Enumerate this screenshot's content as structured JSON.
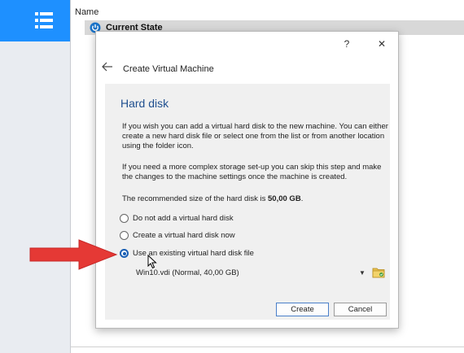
{
  "list": {
    "column_name": "Name",
    "vm_name": "Current State"
  },
  "dialog": {
    "help_label": "?",
    "close_label": "✕",
    "wizard_title": "Create Virtual Machine",
    "page_title": "Hard disk",
    "paragraph1": "If you wish you can add a virtual hard disk to the new machine. You can either create a new hard disk file or select one from the list or from another location using the folder icon.",
    "paragraph2": "If you need a more complex storage set-up you can skip this step and make the changes to the machine settings once the machine is created.",
    "recommended_prefix": "The recommended size of the hard disk is ",
    "recommended_size": "50,00 GB",
    "recommended_suffix": ".",
    "options": [
      {
        "label": "Do not add a virtual hard disk",
        "checked": false
      },
      {
        "label": "Create a virtual hard disk now",
        "checked": false
      },
      {
        "label": "Use an existing virtual hard disk file",
        "checked": true
      }
    ],
    "selected_disk": "Win10.vdi (Normal, 40,00 GB)",
    "create_label": "Create",
    "cancel_label": "Cancel"
  },
  "colors": {
    "accent": "#1e90ff",
    "title_blue": "#1f4f8f",
    "annotation_arrow": "#e53935"
  },
  "icons": [
    "tools-menu-icon",
    "power-icon",
    "back-arrow-icon",
    "folder-icon",
    "dropdown-arrow-icon",
    "mouse-cursor-icon"
  ]
}
